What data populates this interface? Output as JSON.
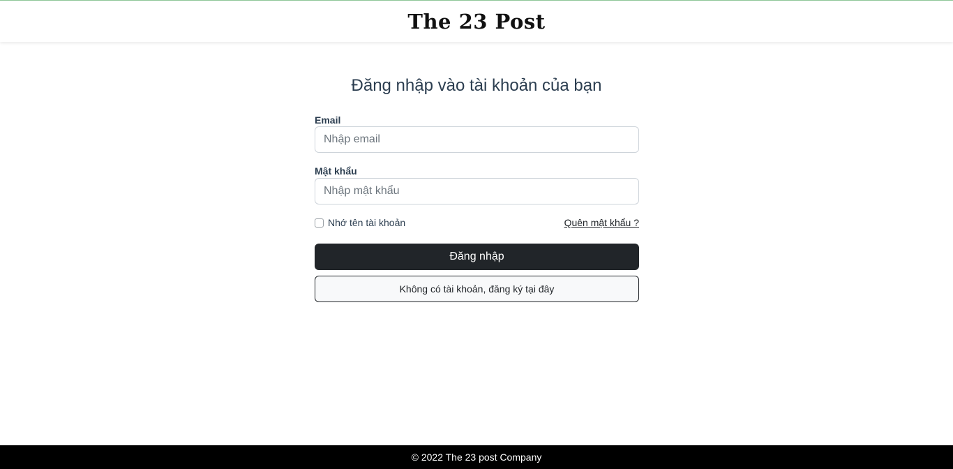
{
  "header": {
    "brand": "The 23 Post"
  },
  "login": {
    "title": "Đăng nhập vào tài khoản của bạn",
    "email_label": "Email",
    "email_placeholder": "Nhập email",
    "email_value": "",
    "password_label": "Mật khẩu",
    "password_placeholder": "Nhập mật khẩu",
    "password_value": "",
    "remember_label": "Nhớ tên tài khoản",
    "remember_checked": false,
    "forgot_label": "Quên mật khẩu ?",
    "submit_label": "Đăng nhập",
    "register_label": "Không có tài khoản, đăng ký tại đây"
  },
  "footer": {
    "copyright": "© 2022 The 23 post Company"
  },
  "colors": {
    "primary_button": "#212529",
    "footer_bg": "#000000",
    "title_text": "#2c3e50"
  }
}
